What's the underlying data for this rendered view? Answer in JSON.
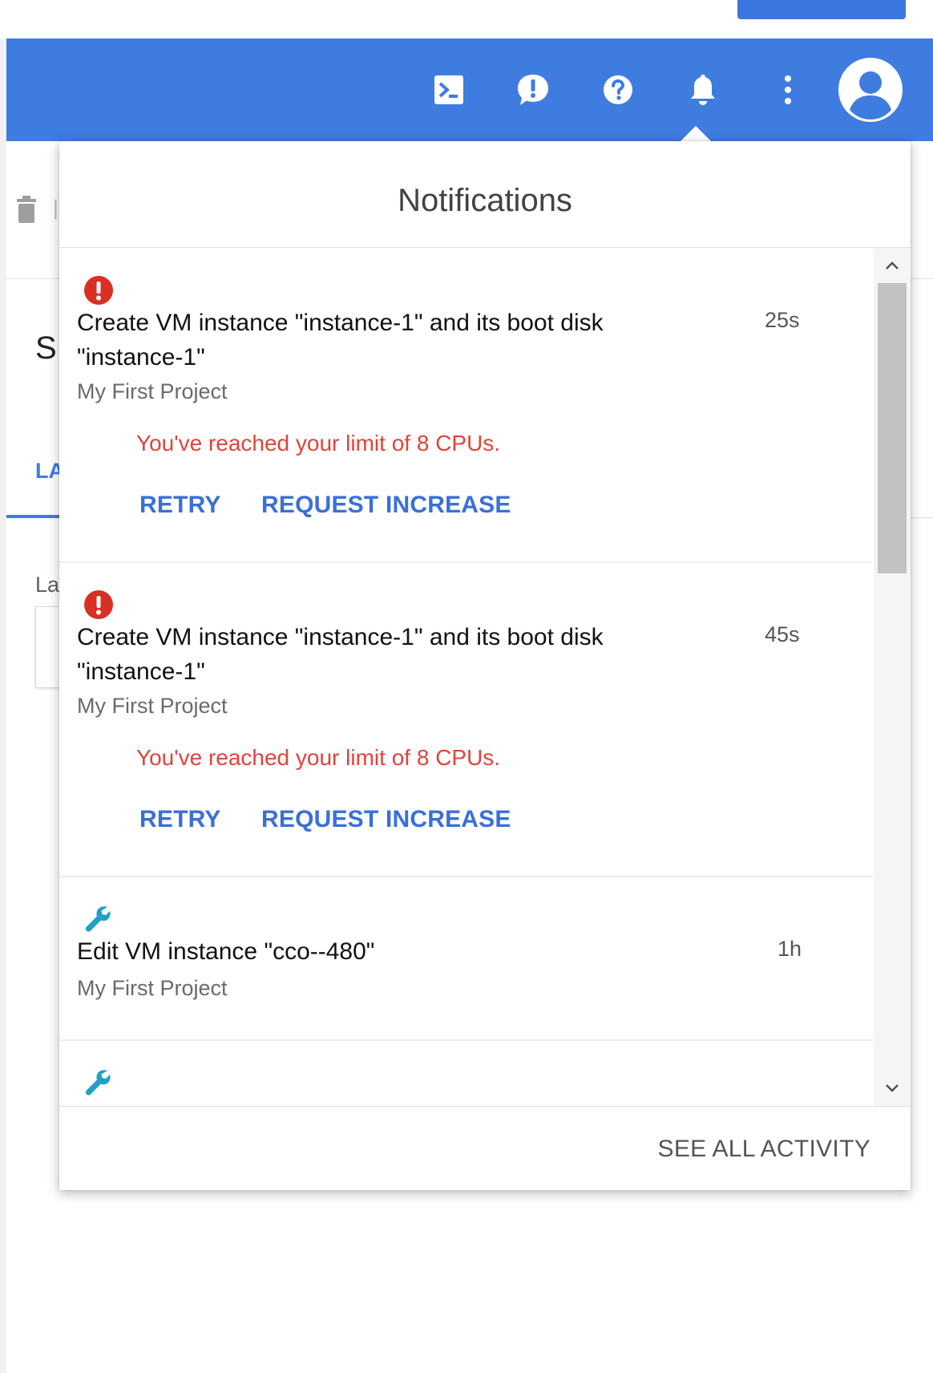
{
  "appbar": {
    "color": "#3f7ce0",
    "icons": [
      "cloud-shell-icon",
      "feedback-icon",
      "help-icon",
      "notifications-icon",
      "more-vert-icon",
      "account-avatar-icon"
    ]
  },
  "background": {
    "heading_partial": "S",
    "tab_partial": "LA",
    "label_partial": "La"
  },
  "popup": {
    "title": "Notifications",
    "items": [
      {
        "icon": "error-icon",
        "title": "Create VM instance \"instance-1\" and its boot disk \"instance-1\"",
        "time": "25s",
        "project": "My First Project",
        "error": "You've reached your limit of 8 CPUs.",
        "actions": [
          "RETRY",
          "REQUEST INCREASE"
        ]
      },
      {
        "icon": "error-icon",
        "title": "Create VM instance \"instance-1\" and its boot disk \"instance-1\"",
        "time": "45s",
        "project": "My First Project",
        "error": "You've reached your limit of 8 CPUs.",
        "actions": [
          "RETRY",
          "REQUEST INCREASE"
        ]
      },
      {
        "icon": "wrench-icon",
        "title": "Edit VM instance \"cco--480\"",
        "time": "1h",
        "project": "My First Project"
      },
      {
        "icon": "wrench-icon"
      }
    ],
    "footer_link": "SEE ALL ACTIVITY"
  },
  "colors": {
    "error": "#e0443c",
    "link": "#3a6fd8",
    "wrench": "#1ea1c7",
    "error_icon": "#d93025"
  }
}
